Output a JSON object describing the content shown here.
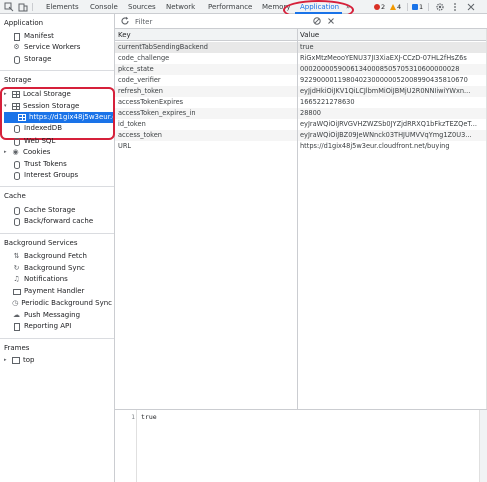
{
  "toolbar": {
    "tabs": [
      {
        "label": "Elements"
      },
      {
        "label": "Console"
      },
      {
        "label": "Sources"
      },
      {
        "label": "Network"
      },
      {
        "label": "Performance"
      },
      {
        "label": "Memory"
      },
      {
        "label": "Application"
      }
    ],
    "active_tab": "Application",
    "more_tabs": "»",
    "errors_count": "2",
    "warnings_count": "4",
    "messages_count": "1",
    "colors": {
      "accent": "#1a73e8",
      "annotation": "#d6203a",
      "error": "#d93025",
      "warning": "#f29900"
    }
  },
  "filter": {
    "placeholder": "Filter",
    "refresh_icon": "refresh-icon",
    "clear_icon": "clear-icon"
  },
  "sidebar": {
    "sections": [
      {
        "title": "Application",
        "items": [
          {
            "label": "Manifest",
            "icon": "document-icon"
          },
          {
            "label": "Service Workers",
            "icon": "gear-icon"
          },
          {
            "label": "Storage",
            "icon": "database-icon"
          }
        ]
      },
      {
        "title": "Storage",
        "items": [
          {
            "label": "Local Storage",
            "icon": "grid-icon",
            "expander": "▸"
          },
          {
            "label": "Session Storage",
            "icon": "grid-icon",
            "expander": "▾"
          },
          {
            "label": "https://d1gix48j5w3eur.cl",
            "icon": "grid-icon",
            "selected": true
          },
          {
            "label": "IndexedDB",
            "icon": "database-icon"
          },
          {
            "label": "Web SQL",
            "icon": "database-icon"
          },
          {
            "label": "Cookies",
            "icon": "cookie-icon",
            "expander": "▸"
          },
          {
            "label": "Trust Tokens",
            "icon": "database-icon"
          },
          {
            "label": "Interest Groups",
            "icon": "database-icon"
          }
        ]
      },
      {
        "title": "Cache",
        "items": [
          {
            "label": "Cache Storage",
            "icon": "database-icon"
          },
          {
            "label": "Back/forward cache",
            "icon": "database-icon"
          }
        ]
      },
      {
        "title": "Background Services",
        "items": [
          {
            "label": "Background Fetch",
            "icon": "arrows-icon"
          },
          {
            "label": "Background Sync",
            "icon": "sync-icon"
          },
          {
            "label": "Notifications",
            "icon": "bell-icon"
          },
          {
            "label": "Payment Handler",
            "icon": "card-icon"
          },
          {
            "label": "Periodic Background Sync",
            "icon": "clock-icon"
          },
          {
            "label": "Push Messaging",
            "icon": "cloud-icon"
          },
          {
            "label": "Reporting API",
            "icon": "document-icon"
          }
        ]
      },
      {
        "title": "Frames",
        "items": [
          {
            "label": "top",
            "icon": "frame-icon",
            "expander": "▸"
          }
        ]
      }
    ]
  },
  "table": {
    "headers": {
      "key": "Key",
      "value": "Value"
    },
    "rows": [
      {
        "key": "currentTabSendingBackend",
        "value": "true"
      },
      {
        "key": "code_challenge",
        "value": "RiGxMtzMeooYENU37JI3XiaEXJ-CCzD-07HL2fHsZ6s"
      },
      {
        "key": "pkce_state",
        "value": "00020000590061340008505705310600000028"
      },
      {
        "key": "code_verifier",
        "value": "9229000011980402300000052008990435810670"
      },
      {
        "key": "refresh_token",
        "value": "eyJjdHkiOiJKV1QiLCJlbmMiOiJBMjU2R0NNIiwiYWxn..."
      },
      {
        "key": "accessTokenExpires",
        "value": "1665221278630"
      },
      {
        "key": "accessToken_expires_in",
        "value": "28800"
      },
      {
        "key": "id_token",
        "value": "eyJraWQiOiJRVGVHZWZSb0JYZjdRRXQ1bFkzTEZQeT..."
      },
      {
        "key": "access_token",
        "value": "eyJraWQiOiJBZ09JeWNnck03THJUMVVqYmg1Z0U3..."
      },
      {
        "key": "URL",
        "value": "https://d1gix48j5w3eur.cloudfront.net/buying"
      }
    ]
  },
  "preview": {
    "line_number": "1",
    "content": "true"
  }
}
